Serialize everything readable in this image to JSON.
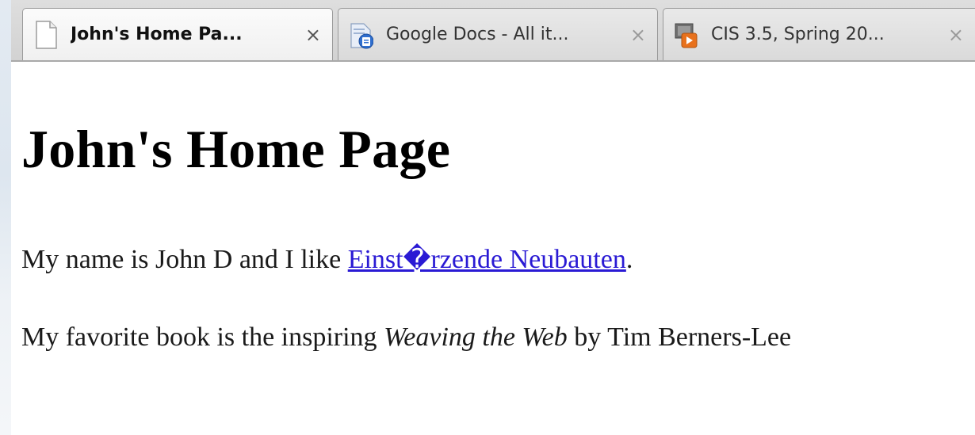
{
  "tabs": [
    {
      "title": "John's Home Pa...",
      "active": true,
      "icon": "blank-page-icon"
    },
    {
      "title": "Google Docs - All it...",
      "active": false,
      "icon": "google-docs-icon"
    },
    {
      "title": "CIS 3.5, Spring 20...",
      "active": false,
      "icon": "slides-presentation-icon"
    }
  ],
  "close_glyph": "×",
  "page": {
    "heading": "John's Home Page",
    "para1_prefix": "My name is John D and I like ",
    "para1_link": "Einst�rzende Neubauten",
    "para1_suffix": ".",
    "para2_prefix": "My favorite book is the inspiring ",
    "para2_book": "Weaving the Web",
    "para2_suffix": " by Tim Berners-Lee"
  },
  "colors": {
    "link": "#2a1ad4",
    "tab_border": "#9a9a9a"
  }
}
